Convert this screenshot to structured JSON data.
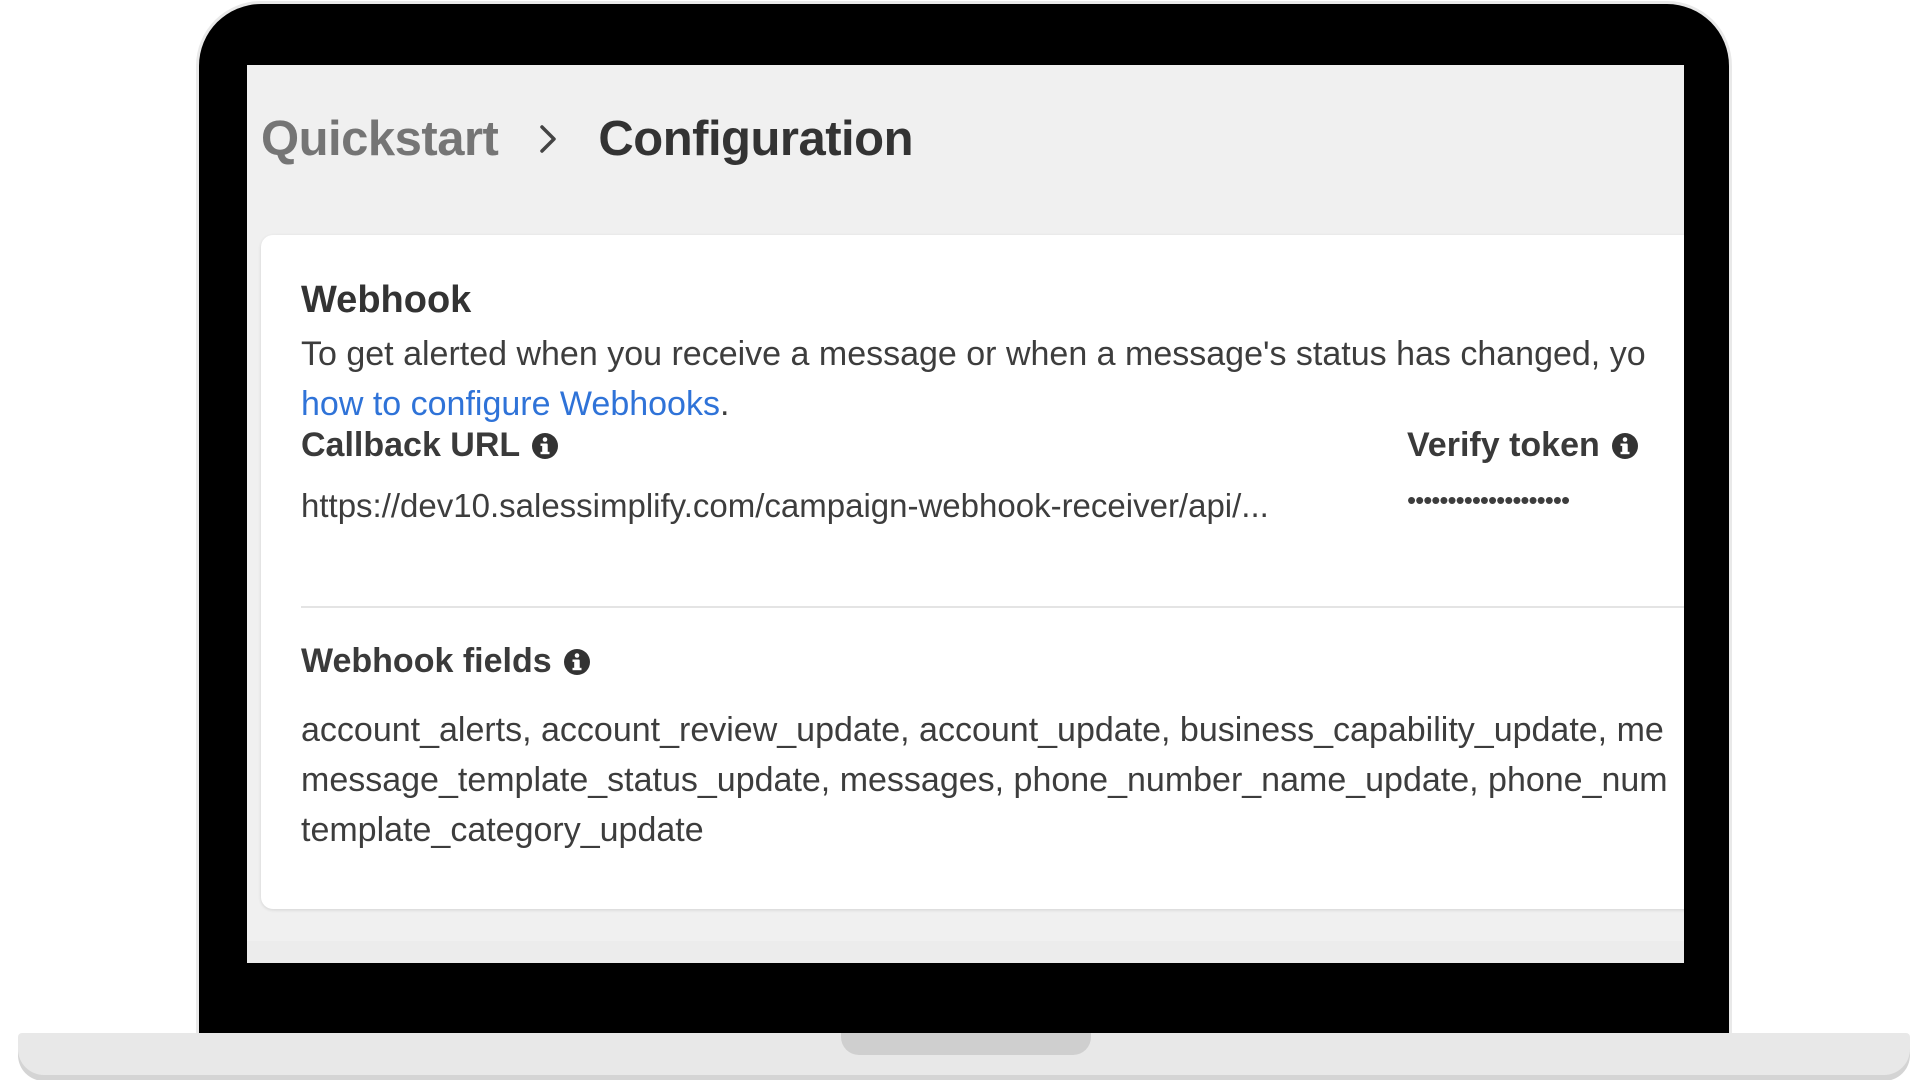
{
  "breadcrumb": {
    "parent": "Quickstart",
    "current": "Configuration",
    "separator_icon": "chevron-right-icon"
  },
  "webhook": {
    "title": "Webhook",
    "description_line1": "To get alerted when you receive a message or when a message's status has changed, yo",
    "link_text": "how to configure Webhooks",
    "after_link": ".",
    "callback_url_label": "Callback URL",
    "callback_url_value": "https://dev10.salessimplify.com/campaign-webhook-receiver/api/...",
    "verify_token_label": "Verify token",
    "verify_token_value": "••••••••••••••••••••",
    "fields_label": "Webhook fields",
    "fields_line1": "account_alerts, account_review_update, account_update, business_capability_update, me",
    "fields_line2": "message_template_status_update, messages, phone_number_name_update, phone_num",
    "fields_line3": "template_category_update"
  },
  "colors": {
    "link": "#2f73d8",
    "screen_background": "#f0f0f0",
    "card_background": "#ffffff",
    "bezel": "#000000"
  }
}
